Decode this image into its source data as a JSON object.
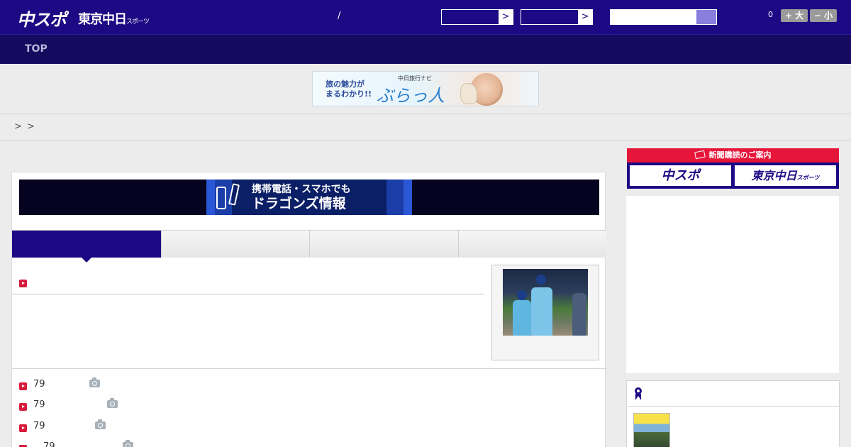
{
  "header": {
    "logo_main": "中スポ",
    "logo_tokyo": "東京中日",
    "logo_tokyo_suffix": "スポーツ",
    "slash": "/",
    "select_arrow": ">",
    "zoom_count": "0",
    "zoom_in_label": "+ 大",
    "zoom_out_label": "− 小"
  },
  "nav": {
    "top_label": "TOP"
  },
  "ad_travel": {
    "tagline_1": "旅の魅力が",
    "tagline_2": "まるわかり!!",
    "sub": "中日旅行ナビ",
    "logo": "ぶらっ人"
  },
  "breadcrumb": {
    "sep1": ">",
    "sep2": ">"
  },
  "mobile_banner": {
    "line1": "携帯電話・スマホでも",
    "line2": "ドラゴンズ情報"
  },
  "news": {
    "items": [
      {
        "num": "79"
      },
      {
        "num": "79"
      },
      {
        "num": "79"
      },
      {
        "num": "79"
      }
    ]
  },
  "subscription": {
    "heading": "新聞購読のご案内",
    "btn_chuspo": "中スポ",
    "btn_tokyo": "東京中日",
    "btn_tokyo_suffix": "スポーツ"
  },
  "colors": {
    "brand_navy": "#1d0984",
    "accent_red": "#e6163a"
  }
}
